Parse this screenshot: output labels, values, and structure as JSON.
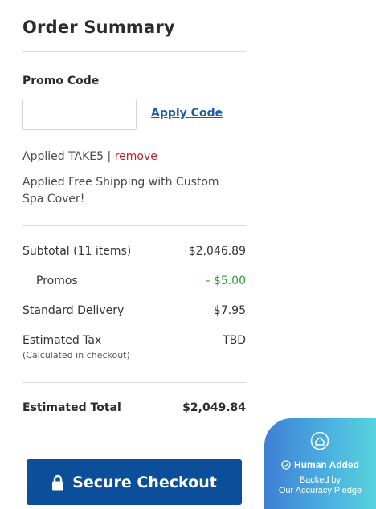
{
  "summary": {
    "title": "Order Summary",
    "promo_label": "Promo Code",
    "promo_input_value": "",
    "apply_label": "Apply Code",
    "applied_code_text": "Applied TAKE5 | ",
    "remove_label": "remove",
    "applied_shipping_text": "Applied Free Shipping with Custom Spa Cover!"
  },
  "lines": {
    "subtotal_label": "Subtotal (11 items)",
    "subtotal_value": "$2,046.89",
    "promos_label": "Promos",
    "promos_value": "- $5.00",
    "delivery_label": "Standard Delivery",
    "delivery_value": "$7.95",
    "tax_label": "Estimated Tax",
    "tax_note": "(Calculated in checkout)",
    "tax_value": "TBD",
    "total_label": "Estimated Total",
    "total_value": "$2,049.84"
  },
  "checkout": {
    "label": "Secure Checkout",
    "icon": "lock-icon",
    "color": "#0b4f9b"
  },
  "badge": {
    "icon": "house-icon",
    "human_added": "Human Added",
    "backed_by": "Backed by",
    "pledge": "Our Accuracy Pledge"
  },
  "colors": {
    "promo_discount": "#2e9b3a",
    "link": "#1a5fa8",
    "remove_link": "#b3262d"
  }
}
